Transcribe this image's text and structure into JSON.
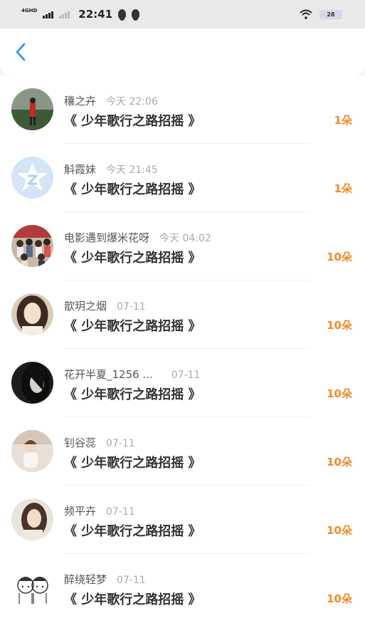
{
  "status_bar": {
    "network": "4GHD",
    "time": "22:41",
    "battery": "28"
  },
  "nav": {
    "back_icon": "chevron-left-icon",
    "accent": "#2196f3"
  },
  "colors": {
    "count": "#f08a2b",
    "avatar_placeholder": "#cfe3f7"
  },
  "items": [
    {
      "name": "穰之卉",
      "time": "今天 22:06",
      "song": "《 少年歌行之路招摇 》",
      "count": "1朵"
    },
    {
      "name": "斛霞妹",
      "time": "今天 21:45",
      "song": "《 少年歌行之路招摇 》",
      "count": "1朵"
    },
    {
      "name": "电影遇到爆米花呀",
      "time": "今天 04:02",
      "song": "《 少年歌行之路招摇 》",
      "count": "10朵"
    },
    {
      "name": "歆玥之烟",
      "time": "07-11",
      "song": "《 少年歌行之路招摇 》",
      "count": "10朵"
    },
    {
      "name": "花开半夏_1256 ...",
      "time": "07-11",
      "song": "《 少年歌行之路招摇 》",
      "count": "10朵"
    },
    {
      "name": "钊谷蕊",
      "time": "07-11",
      "song": "《 少年歌行之路招摇 》",
      "count": "10朵"
    },
    {
      "name": "频平卉",
      "time": "07-11",
      "song": "《 少年歌行之路招摇 》",
      "count": "10朵"
    },
    {
      "name": "醉绕轻梦",
      "time": "07-11",
      "song": "《 少年歌行之路招摇 》",
      "count": "10朵"
    }
  ]
}
